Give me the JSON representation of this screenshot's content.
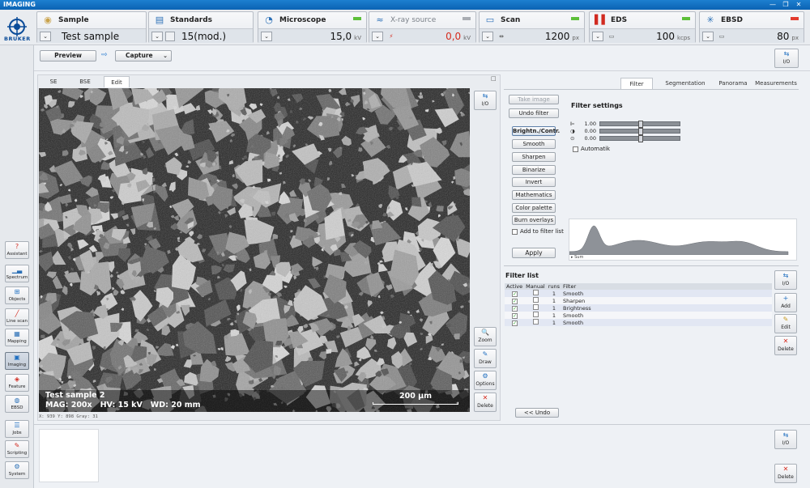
{
  "window": {
    "title": "IMAGING",
    "min_icon": "minimize-icon",
    "max_icon": "maximize-icon",
    "close_icon": "close-icon",
    "min_glyph": "—",
    "max_glyph": "❐",
    "close_glyph": "✕"
  },
  "logo": {
    "text": "BRUKER"
  },
  "tiles": [
    {
      "name": "Sample",
      "icon": "sample-icon",
      "value": "Test sample",
      "led": "none"
    },
    {
      "name": "Standards",
      "icon": "standards-icon",
      "value": "15(mod.)",
      "led": "none"
    },
    {
      "name": "Microscope",
      "icon": "microscope-icon",
      "value": "15,0",
      "unit": "kV",
      "led": "green"
    },
    {
      "name": "X-ray source",
      "icon": "xray-source-icon",
      "value": "0,0",
      "unit": "kV",
      "led": "gray"
    },
    {
      "name": "Scan",
      "icon": "scan-icon",
      "value": "1200",
      "unit": "px",
      "led": "green"
    },
    {
      "name": "EDS",
      "icon": "eds-icon",
      "value": "100",
      "unit": "kcps",
      "led": "green"
    },
    {
      "name": "EBSD",
      "icon": "ebsd-icon",
      "value": "80",
      "unit": "px",
      "led": "red"
    }
  ],
  "leftnav": [
    {
      "label": "Assistant",
      "icon": "assistant-icon",
      "glyph": "?"
    },
    {
      "label": "Spectrum",
      "icon": "spectrum-icon",
      "glyph": "▁▃"
    },
    {
      "label": "Objects",
      "icon": "objects-icon",
      "glyph": "⊞"
    },
    {
      "label": "Line scan",
      "icon": "line-scan-icon",
      "glyph": "╱"
    },
    {
      "label": "Mapping",
      "icon": "mapping-icon",
      "glyph": "▦"
    },
    {
      "label": "Imaging",
      "icon": "imaging-icon",
      "glyph": "▣"
    },
    {
      "label": "Feature",
      "icon": "feature-icon",
      "glyph": "◈"
    },
    {
      "label": "EBSD",
      "icon": "ebsd-nav-icon",
      "glyph": "◍"
    },
    {
      "label": "Jobs",
      "icon": "jobs-icon",
      "glyph": "☰"
    },
    {
      "label": "Scripting",
      "icon": "scripting-icon",
      "glyph": "✎"
    },
    {
      "label": "System",
      "icon": "system-icon",
      "glyph": "⚙"
    }
  ],
  "toolbar": {
    "preview": "Preview",
    "capture": "Capture",
    "arrow": "⇨",
    "io": "I/O",
    "io_glyph": "⇆"
  },
  "image_tabs": [
    "SE",
    "BSE",
    "Edit"
  ],
  "image_panel": {
    "max_glyph": "□"
  },
  "image": {
    "sample": "Test sample 2",
    "mag": "MAG: 200x",
    "hv": "HV: 15 kV",
    "wd": "WD: 20 mm",
    "scale": "200 µm",
    "coords": "X: 939   Y: 898  Gray: 31"
  },
  "image_side_buttons": [
    {
      "label": "I/O",
      "glyph": "⇆",
      "icon": "io-icon"
    },
    {
      "label": "Zoom",
      "glyph": "🔍",
      "icon": "zoom-icon"
    },
    {
      "label": "Draw",
      "glyph": "✎",
      "icon": "draw-icon"
    },
    {
      "label": "Options",
      "glyph": "⚙",
      "icon": "options-icon"
    },
    {
      "label": "Delete",
      "glyph": "✕",
      "icon": "delete-icon"
    }
  ],
  "right_tabs": [
    "Filter",
    "Segmentation",
    "Panorama",
    "Measurements"
  ],
  "filter": {
    "take_image": "Take image",
    "undo_filter": "Undo filter",
    "buttons": [
      "Brightn./Contr.",
      "Smooth",
      "Sharpen",
      "Binarize",
      "Invert",
      "Mathematics",
      "Color palette",
      "Burn overlays"
    ],
    "add_to_list": "Add to filter list",
    "apply": "Apply",
    "settings_title": "Filter settings",
    "sliders": [
      {
        "icon": "contrast-icon",
        "glyph": "⊫",
        "value": "1.00",
        "pos": 0.5
      },
      {
        "icon": "brightness-icon",
        "glyph": "◑",
        "value": "0.00",
        "pos": 0.5
      },
      {
        "icon": "gamma-icon",
        "glyph": "⊙",
        "value": "0.00",
        "pos": 0.5
      }
    ],
    "automatik": "Automatik",
    "hist_label": "Sum"
  },
  "filter_list": {
    "title": "Filter list",
    "headers": [
      "Active",
      "Manual",
      "runs",
      "Filter"
    ],
    "rows": [
      {
        "active": true,
        "manual": false,
        "runs": "1",
        "filter": "Smooth"
      },
      {
        "active": true,
        "manual": false,
        "runs": "1",
        "filter": "Sharpen"
      },
      {
        "active": true,
        "manual": false,
        "runs": "1",
        "filter": "Brightness"
      },
      {
        "active": true,
        "manual": false,
        "runs": "1",
        "filter": "Smooth"
      },
      {
        "active": true,
        "manual": false,
        "runs": "1",
        "filter": "Smooth"
      }
    ],
    "side_buttons": [
      {
        "label": "I/O",
        "glyph": "⇆",
        "icon": "io-icon"
      },
      {
        "label": "Add",
        "glyph": "+",
        "icon": "add-icon"
      },
      {
        "label": "Edit",
        "glyph": "✎",
        "icon": "edit-icon"
      },
      {
        "label": "Delete",
        "glyph": "✕",
        "icon": "delete-icon"
      }
    ],
    "undo": "<< Undo"
  },
  "bottom_buttons": [
    {
      "label": "I/O",
      "glyph": "⇆",
      "icon": "io-icon"
    },
    {
      "label": "Delete",
      "glyph": "✕",
      "icon": "delete-icon"
    }
  ]
}
